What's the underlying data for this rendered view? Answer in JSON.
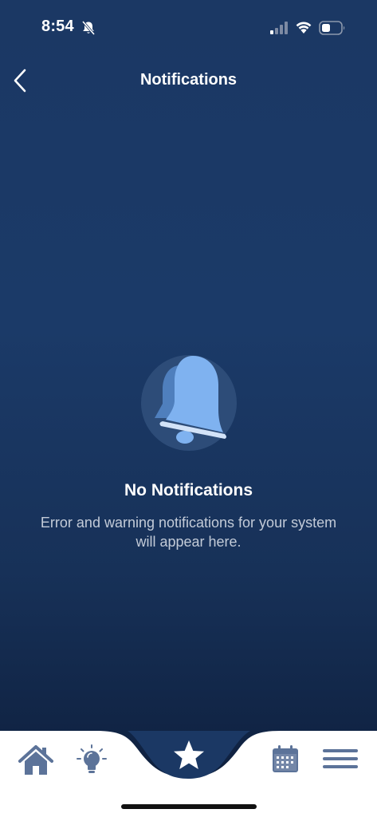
{
  "status_bar": {
    "time": "8:54",
    "icons": [
      "mute-icon",
      "cellular-signal-icon",
      "wifi-icon",
      "battery-icon"
    ]
  },
  "header": {
    "title": "Notifications",
    "back_icon": "chevron-left-icon"
  },
  "empty_state": {
    "icon": "bell-icon",
    "title": "No Notifications",
    "message": "Error and warning notifications for your system will appear here."
  },
  "bottom_nav": {
    "items": [
      {
        "id": "home",
        "icon": "home-icon"
      },
      {
        "id": "insights",
        "icon": "lightbulb-icon"
      },
      {
        "id": "favorites",
        "icon": "star-icon",
        "active": true
      },
      {
        "id": "schedule",
        "icon": "calendar-icon"
      },
      {
        "id": "menu",
        "icon": "hamburger-menu-icon"
      }
    ]
  },
  "colors": {
    "background_top": "#1b3864",
    "background_bottom": "#0d1d3a",
    "accent_blue": "#7fb2f0",
    "nav_icon": "#5c7399",
    "nav_active_bg": "#1b3864",
    "text_primary": "#ffffff",
    "text_secondary": "#c3cbd8"
  }
}
